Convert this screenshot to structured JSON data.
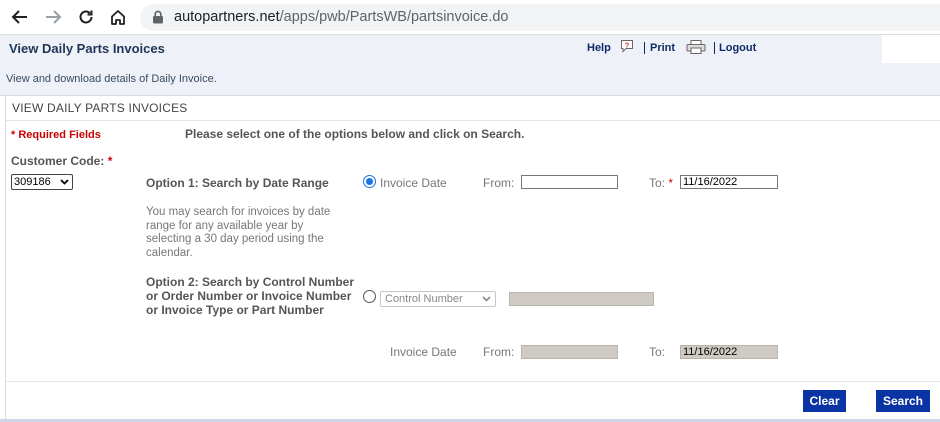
{
  "browser": {
    "url_host": "autopartners.net",
    "url_path": "/apps/pwb/PartsWB/partsinvoice.do"
  },
  "header": {
    "title": "View Daily Parts Invoices",
    "help_label": "Help",
    "print_label": "Print",
    "logout_label": "Logout"
  },
  "description": "View and download details of Daily Invoice.",
  "panel": {
    "heading": "VIEW DAILY PARTS INVOICES",
    "required_fields": "* Required Fields",
    "instruction": "Please select one of the options below and click on Search."
  },
  "customer": {
    "label": "Customer Code:",
    "required_mark": "*",
    "selected": "309186"
  },
  "option1": {
    "title": "Option 1: Search by Date Range",
    "help_text": "You may search for invoices by date range for any available year by selecting a 30 day period using the calendar.",
    "radio_label": "Invoice Date",
    "from_label": "From:",
    "from_value": "",
    "to_label": "To:",
    "to_required": "*",
    "to_value": "11/16/2022",
    "selected": true
  },
  "option2": {
    "title": "Option 2: Search by Control Number or Order Number or Invoice Number or Invoice Type or Part Number",
    "select_value": "Control Number",
    "search_value": "",
    "date_label": "Invoice Date",
    "from_label": "From:",
    "from_value": "",
    "to_label": "To:",
    "to_value": "11/16/2022",
    "selected": false
  },
  "actions": {
    "clear_label": "Clear",
    "search_label": "Search"
  },
  "colors": {
    "button_bg": "#0a33a3",
    "required_red": "#cc0000",
    "header_bg": "#eef2f8",
    "radio_blue": "#1a73e8"
  }
}
